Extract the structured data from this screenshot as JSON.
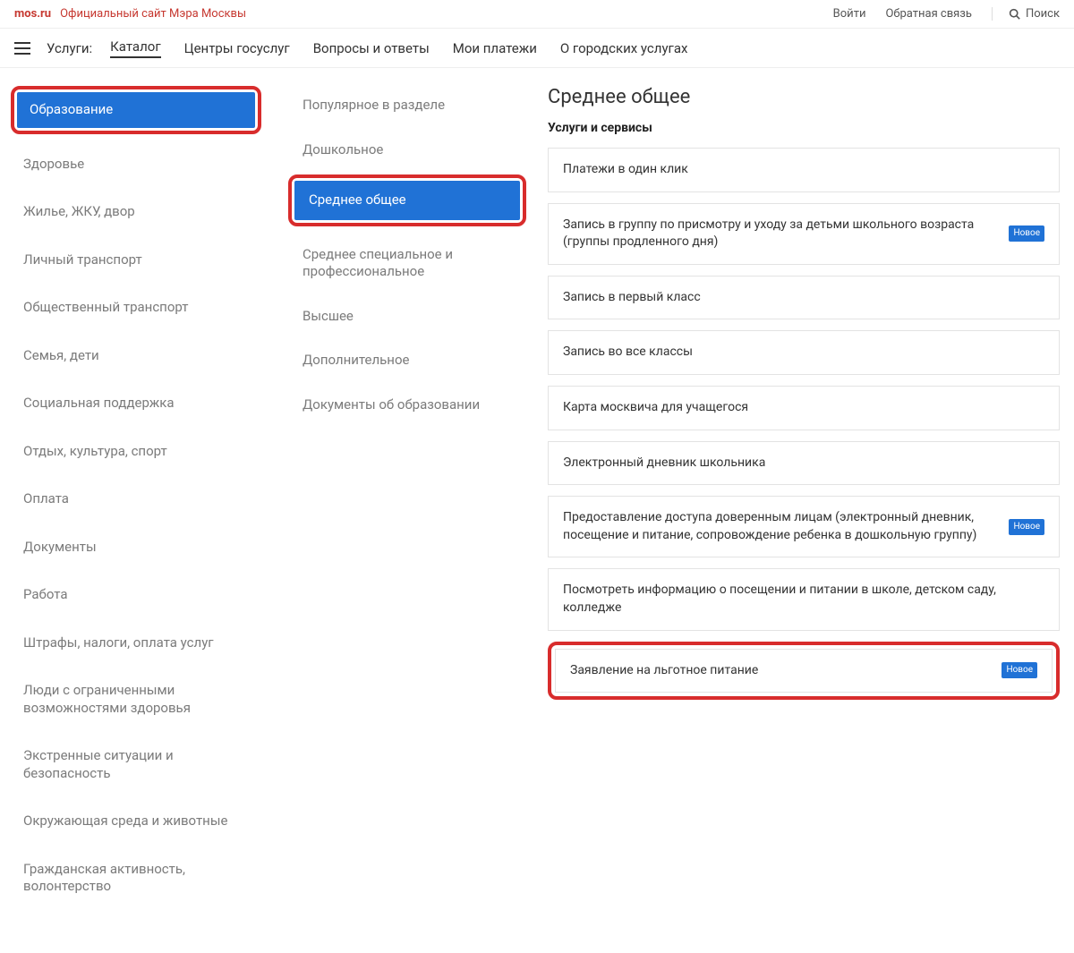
{
  "topbar": {
    "logo": "mos.ru",
    "site_desc": "Официальный сайт Мэра Москвы",
    "login": "Войти",
    "feedback": "Обратная связь",
    "search": "Поиск"
  },
  "navbar": {
    "services_label": "Услуги:",
    "items": [
      {
        "label": "Каталог",
        "active": true
      },
      {
        "label": "Центры госуслуг"
      },
      {
        "label": "Вопросы и ответы"
      },
      {
        "label": "Мои платежи"
      },
      {
        "label": "О городских услугах"
      }
    ]
  },
  "categories": [
    {
      "label": "Образование",
      "active": true,
      "highlighted": true
    },
    {
      "label": "Здоровье"
    },
    {
      "label": "Жилье, ЖКУ, двор"
    },
    {
      "label": "Личный транспорт"
    },
    {
      "label": "Общественный транспорт"
    },
    {
      "label": "Семья, дети"
    },
    {
      "label": "Социальная поддержка"
    },
    {
      "label": "Отдых, культура, спорт"
    },
    {
      "label": "Оплата"
    },
    {
      "label": "Документы"
    },
    {
      "label": "Работа"
    },
    {
      "label": "Штрафы, налоги, оплата услуг"
    },
    {
      "label": "Люди с ограниченными возможностями здоровья"
    },
    {
      "label": "Экстренные ситуации и безопасность"
    },
    {
      "label": "Окружающая среда и животные"
    },
    {
      "label": "Гражданская активность, волонтерство"
    }
  ],
  "subcategories": [
    {
      "label": "Популярное в разделе"
    },
    {
      "label": "Дошкольное"
    },
    {
      "label": "Среднее общее",
      "active": true,
      "highlighted": true
    },
    {
      "label": "Среднее специальное и профессиональное"
    },
    {
      "label": "Высшее"
    },
    {
      "label": "Дополнительное"
    },
    {
      "label": "Документы об образовании"
    }
  ],
  "right": {
    "title": "Среднее общее",
    "section_label": "Услуги и сервисы",
    "badge_new": "Новое",
    "services": [
      {
        "text": "Платежи в один клик"
      },
      {
        "text": "Запись в группу по присмотру и уходу за детьми школьного возраста (группы продленного дня)",
        "new": true
      },
      {
        "text": "Запись в первый класс"
      },
      {
        "text": "Запись во все классы"
      },
      {
        "text": "Карта москвича для учащегося"
      },
      {
        "text": "Электронный дневник школьника"
      },
      {
        "text": "Предоставление доступа доверенным лицам (электронный дневник, посещение и питание, сопровождение ребенка в дошкольную группу)",
        "new": true
      },
      {
        "text": "Посмотреть информацию о посещении и питании в школе, детском саду, колледже"
      },
      {
        "text": "Заявление на льготное питание",
        "new": true,
        "highlighted": true
      }
    ]
  }
}
